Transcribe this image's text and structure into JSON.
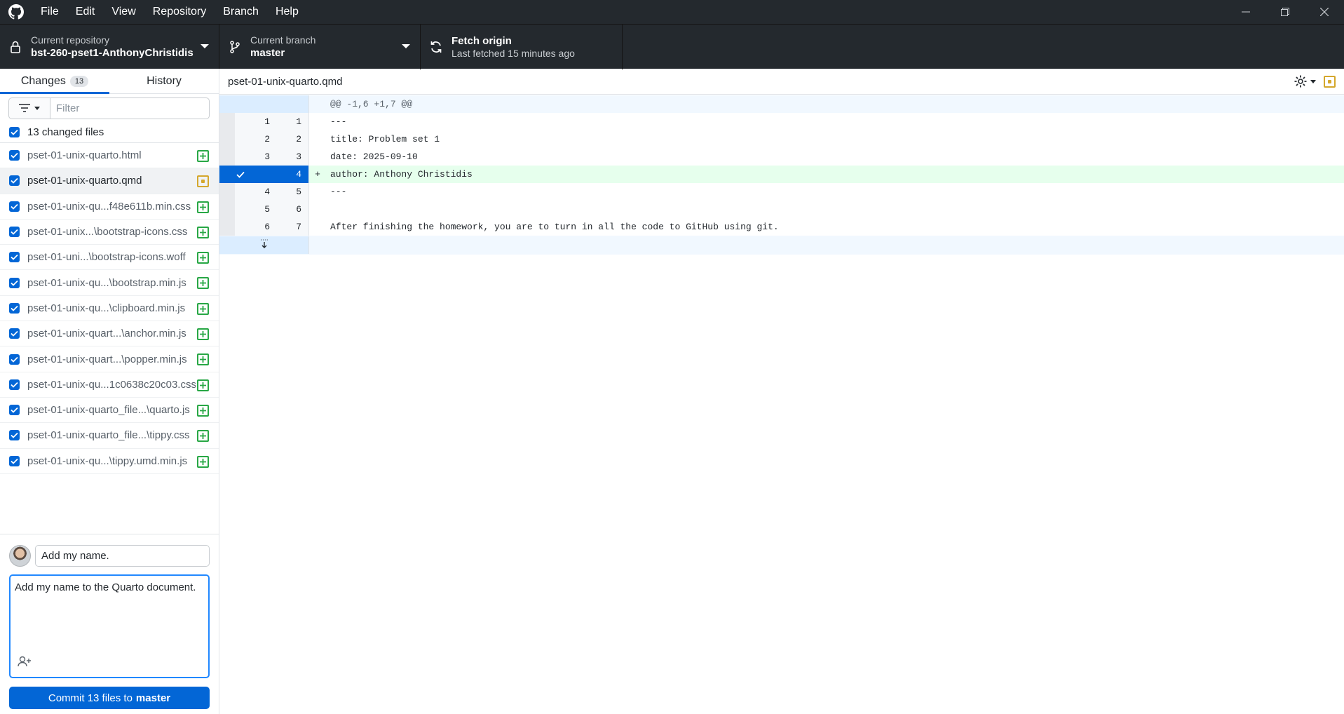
{
  "menu": [
    "File",
    "Edit",
    "View",
    "Repository",
    "Branch",
    "Help"
  ],
  "toolbar": {
    "repo_label": "Current repository",
    "repo_name": "bst-260-pset1-AnthonyChristidis",
    "branch_label": "Current branch",
    "branch_name": "master",
    "fetch_title": "Fetch origin",
    "fetch_sub": "Last fetched 15 minutes ago"
  },
  "tabs": {
    "changes": "Changes",
    "changes_count": "13",
    "history": "History"
  },
  "filter": {
    "placeholder": "Filter"
  },
  "changed_files_label": "13 changed files",
  "files": [
    {
      "name": "pset-01-unix-quarto.html",
      "status": "added"
    },
    {
      "name": "pset-01-unix-quarto.qmd",
      "status": "modified"
    },
    {
      "name": "pset-01-unix-qu...f48e611b.min.css",
      "status": "added"
    },
    {
      "name": "pset-01-unix...\\bootstrap-icons.css",
      "status": "added"
    },
    {
      "name": "pset-01-uni...\\bootstrap-icons.woff",
      "status": "added"
    },
    {
      "name": "pset-01-unix-qu...\\bootstrap.min.js",
      "status": "added"
    },
    {
      "name": "pset-01-unix-qu...\\clipboard.min.js",
      "status": "added"
    },
    {
      "name": "pset-01-unix-quart...\\anchor.min.js",
      "status": "added"
    },
    {
      "name": "pset-01-unix-quart...\\popper.min.js",
      "status": "added"
    },
    {
      "name": "pset-01-unix-qu...1c0638c20c03.css",
      "status": "added"
    },
    {
      "name": "pset-01-unix-quarto_file...\\quarto.js",
      "status": "added"
    },
    {
      "name": "pset-01-unix-quarto_file...\\tippy.css",
      "status": "added"
    },
    {
      "name": "pset-01-unix-qu...\\tippy.umd.min.js",
      "status": "added"
    }
  ],
  "commit": {
    "summary": "Add my name.",
    "description": "Add my name to the Quarto document.",
    "button_prefix": "Commit 13 files to",
    "button_branch": "master"
  },
  "diff": {
    "file": "pset-01-unix-quarto.qmd",
    "hunk": "@@ -1,6 +1,7 @@",
    "lines": [
      {
        "old": "1",
        "new": "1",
        "type": "context",
        "text": "---"
      },
      {
        "old": "2",
        "new": "2",
        "type": "context",
        "text": "title: Problem set 1"
      },
      {
        "old": "3",
        "new": "3",
        "type": "context",
        "text": "date: 2025-09-10"
      },
      {
        "old": "",
        "new": "4",
        "type": "added",
        "marker": "+",
        "text": "author: Anthony Christidis"
      },
      {
        "old": "4",
        "new": "5",
        "type": "context",
        "text": "---"
      },
      {
        "old": "5",
        "new": "6",
        "type": "context",
        "text": ""
      },
      {
        "old": "6",
        "new": "7",
        "type": "context",
        "text": "After finishing the homework, you are to turn in all the code to GitHub using git."
      }
    ]
  }
}
